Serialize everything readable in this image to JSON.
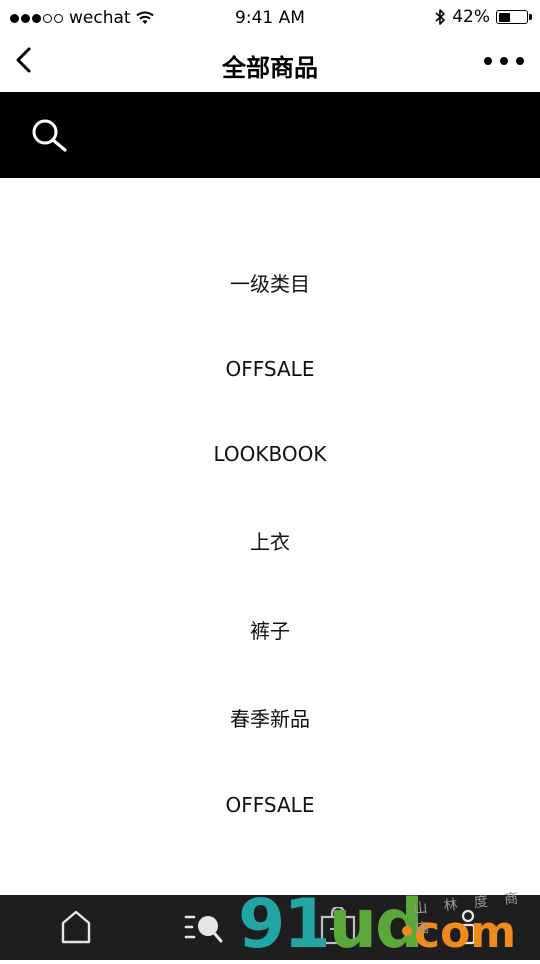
{
  "status_bar": {
    "carrier": "wechat",
    "time": "9:41 AM",
    "battery_text": "42%",
    "battery_level": 0.42,
    "signal_strength": 3,
    "signal_total": 5
  },
  "nav": {
    "title": "全部商品",
    "back_icon": "chevron-left-icon",
    "more_icon": "more-horizontal-icon"
  },
  "search": {
    "icon": "search-icon",
    "background_color": "#000000"
  },
  "categories": [
    {
      "label": "一级类目"
    },
    {
      "label": "OFFSALE"
    },
    {
      "label": "LOOKBOOK"
    },
    {
      "label": "上衣"
    },
    {
      "label": "裤子"
    },
    {
      "label": "春季新品"
    },
    {
      "label": "OFFSALE"
    }
  ],
  "tab_bar": {
    "background_color": "#1e1e1e",
    "tabs": [
      {
        "icon": "home-icon"
      },
      {
        "icon": "category-search-icon"
      },
      {
        "icon": "shopping-bag-icon"
      },
      {
        "icon": "user-icon"
      }
    ]
  },
  "watermark": {
    "main_91": "91",
    "main_ud": "ud",
    "suffix": "com",
    "subtext": "山 林 度 商 店"
  }
}
